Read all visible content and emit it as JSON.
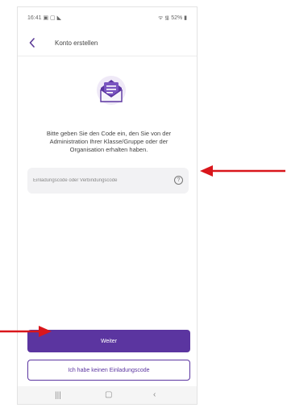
{
  "status_bar": {
    "left": "16:41 ▣ ▢ ◣",
    "right": "ᯤ ᯾ 52% ▮"
  },
  "app_bar": {
    "back_icon": "chevron-left-icon",
    "title": "Konto erstellen"
  },
  "hero_icon": "envelope-with-letter-icon",
  "message_lines": [
    "Bitte geben Sie den Code ein, den Sie von der",
    "Administration Ihrer Klasse/Gruppe oder der",
    "Organisation erhalten haben."
  ],
  "code_field": {
    "placeholder": "Einladungscode oder Verbindungscode",
    "value": "",
    "help_icon": "question-circle-icon"
  },
  "buttons": {
    "next": "Weiter",
    "no_code": "Ich habe keinen Einladungscode"
  },
  "nav_bar": {
    "recent": "|||",
    "home": "▢",
    "back": "‹"
  },
  "colors": {
    "accent": "#5b35a0",
    "field_bg": "#f2f2f4",
    "annotation_arrow": "#d9161b"
  }
}
